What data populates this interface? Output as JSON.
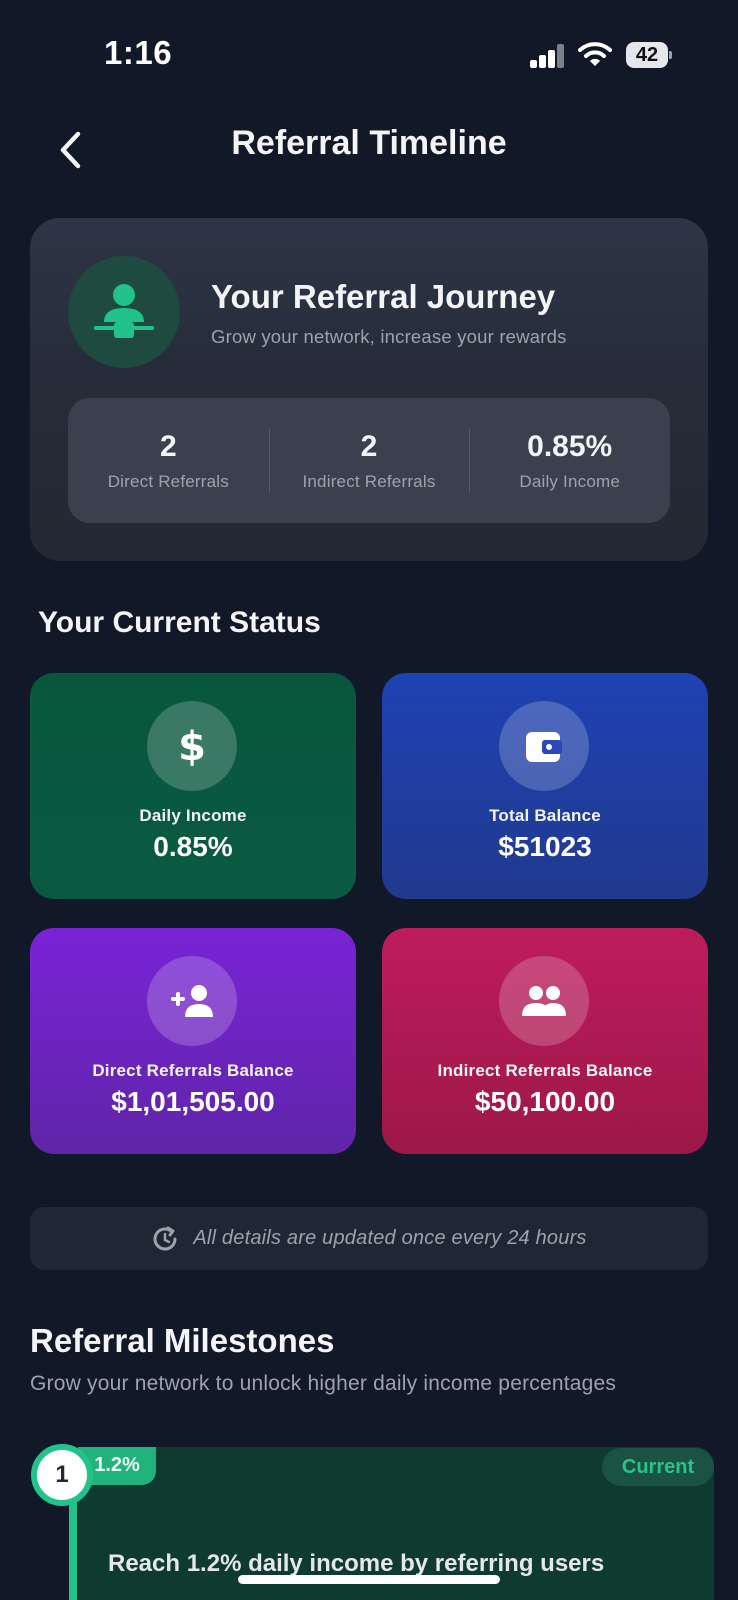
{
  "status_bar": {
    "time": "1:16",
    "battery": "42"
  },
  "header": {
    "title": "Referral Timeline"
  },
  "journey": {
    "title": "Your Referral Journey",
    "subtitle": "Grow your network, increase your rewards",
    "stats": [
      {
        "value": "2",
        "label": "Direct Referrals"
      },
      {
        "value": "2",
        "label": "Indirect Referrals"
      },
      {
        "value": "0.85%",
        "label": "Daily Income"
      }
    ]
  },
  "current_status": {
    "title": "Your Current Status",
    "tiles": [
      {
        "label": "Daily Income",
        "value": "0.85%",
        "icon": "dollar-icon",
        "color": "#08573d"
      },
      {
        "label": "Total Balance",
        "value": "$51023",
        "icon": "wallet-icon",
        "color": "#1f42b4"
      },
      {
        "label": "Direct Referrals Balance",
        "value": "$1,01,505.00",
        "icon": "user-plus-icon",
        "color": "#7a23d6"
      },
      {
        "label": "Indirect Referrals Balance",
        "value": "$50,100.00",
        "icon": "users-icon",
        "color": "#be1c5c"
      }
    ]
  },
  "info": {
    "text": "All details are updated once every 24 hours",
    "icon": "clock-refresh-icon"
  },
  "milestones": {
    "title": "Referral Milestones",
    "subtitle": "Grow your network to unlock higher daily income percentages",
    "items": [
      {
        "number": "1",
        "percent": "1.2%",
        "badge": "Current",
        "description": "Reach 1.2% daily income by referring users"
      }
    ]
  },
  "colors": {
    "accent": "#22c38a",
    "background": "#111827"
  }
}
